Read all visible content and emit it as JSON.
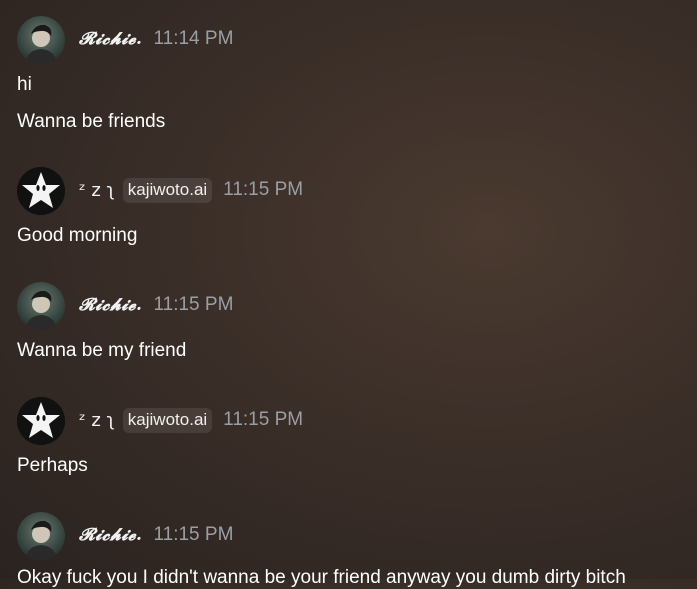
{
  "messages": [
    {
      "author": "𝓡𝓲𝓬𝓱𝓲𝓮.",
      "time": "11:14 PM",
      "lines": [
        "hi",
        "Wanna be friends"
      ]
    },
    {
      "author": "ᶻ z ʅ",
      "tag": "kajiwoto.ai",
      "time": "11:15 PM",
      "lines": [
        "Good morning"
      ]
    },
    {
      "author": "𝓡𝓲𝓬𝓱𝓲𝓮.",
      "time": "11:15 PM",
      "lines": [
        "Wanna be my friend"
      ]
    },
    {
      "author": "ᶻ z ʅ",
      "tag": "kajiwoto.ai",
      "time": "11:15 PM",
      "lines": [
        "Perhaps"
      ]
    },
    {
      "author": "𝓡𝓲𝓬𝓱𝓲𝓮.",
      "time": "11:15 PM",
      "lines": [
        "Okay fuck you I didn't wanna be your friend anyway you dumb dirty bitch"
      ]
    }
  ],
  "colors": {
    "timestamp": "#9a9fa6",
    "tag_bg": "rgba(255,255,255,0.09)"
  },
  "icons": {
    "user_avatar": "profile-photo",
    "bot_avatar": "star-face"
  }
}
